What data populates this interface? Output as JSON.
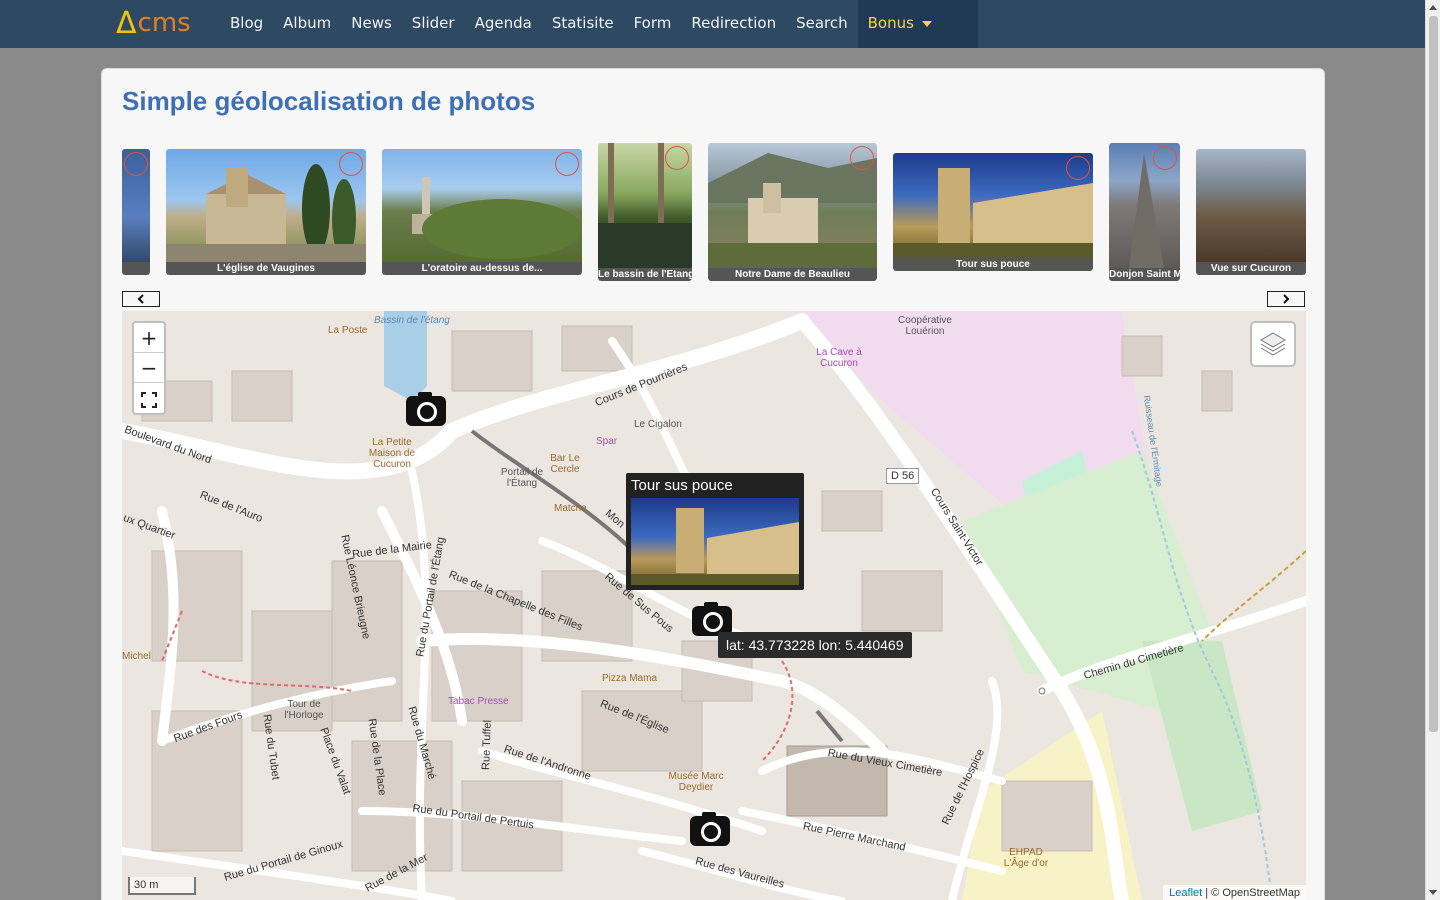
{
  "brand": {
    "logo_delta": "Δ",
    "logo_text": "cms"
  },
  "nav": {
    "items": [
      "Blog",
      "Album",
      "News",
      "Slider",
      "Agenda",
      "Statisite",
      "Form",
      "Redirection",
      "Search"
    ],
    "active": "Bonus"
  },
  "page": {
    "title": "Simple géolocalisation de photos"
  },
  "carousel": {
    "prev_icon": "chevron-left-icon",
    "next_icon": "chevron-right-icon",
    "photos": [
      {
        "caption": ""
      },
      {
        "caption": "L'église de Vaugines"
      },
      {
        "caption": "L'oratoire au-dessus de..."
      },
      {
        "caption": "Le bassin de l'Etang"
      },
      {
        "caption": "Notre Dame de Beaulieu"
      },
      {
        "caption": "Tour sus pouce"
      },
      {
        "caption": "Donjon Saint M"
      },
      {
        "caption": "Vue sur Cucuron"
      }
    ]
  },
  "map": {
    "zoom_in": "+",
    "zoom_out": "−",
    "popup_title": "Tour sus pouce",
    "tooltip": "lat: 43.773228 lon: 5.440469",
    "scale": "30 m",
    "attribution_leaflet": "Leaflet",
    "attribution_rest": "| © OpenStreetMap",
    "streets": [
      "Boulevard du Nord",
      "Rue de l'Auro",
      "ux Quartier",
      "Rue Léonce Brieugne",
      "Rue de la Mairie",
      "Rue du Portail de l'Étang",
      "Rue de la Chapelle des Filles",
      "Rue de Sus Pous",
      "Cours de Pourrières",
      "Rue de l'Église",
      "Rue de l'Andronne",
      "Rue Tuffel",
      "Rue du Marché",
      "Rue de la Place",
      "Place du Valat",
      "Rue du Tubet",
      "Rue des Fours",
      "Rue du Portail de Pertuis",
      "Rue du Portail de Ginoux",
      "Rue de la Mer",
      "Rue des Vaureilles",
      "Rue Pierre Marchand",
      "Rue du Vieux Cimetière",
      "Rue de l'Hospice",
      "Cours Saint-Victor",
      "Chemin du Cimetière",
      "D 56",
      "Ruisseau de l'Ermitage",
      "Mon"
    ],
    "pois": [
      "La Poste",
      "Bassin de l'étang",
      "La Petite Maison de Cucuron",
      "Portail de l'Étang",
      "Bar Le Cercle",
      "Spar",
      "Le Cigalon",
      "Matcha",
      "Coopérative Louérion",
      "La Cave à Cucuron",
      "Tour de l'Horloge",
      "Tabac Presse",
      "Pizza Mama",
      "Musée Marc Deydier",
      "EHPAD L'Âge d'or",
      "Michel"
    ]
  }
}
